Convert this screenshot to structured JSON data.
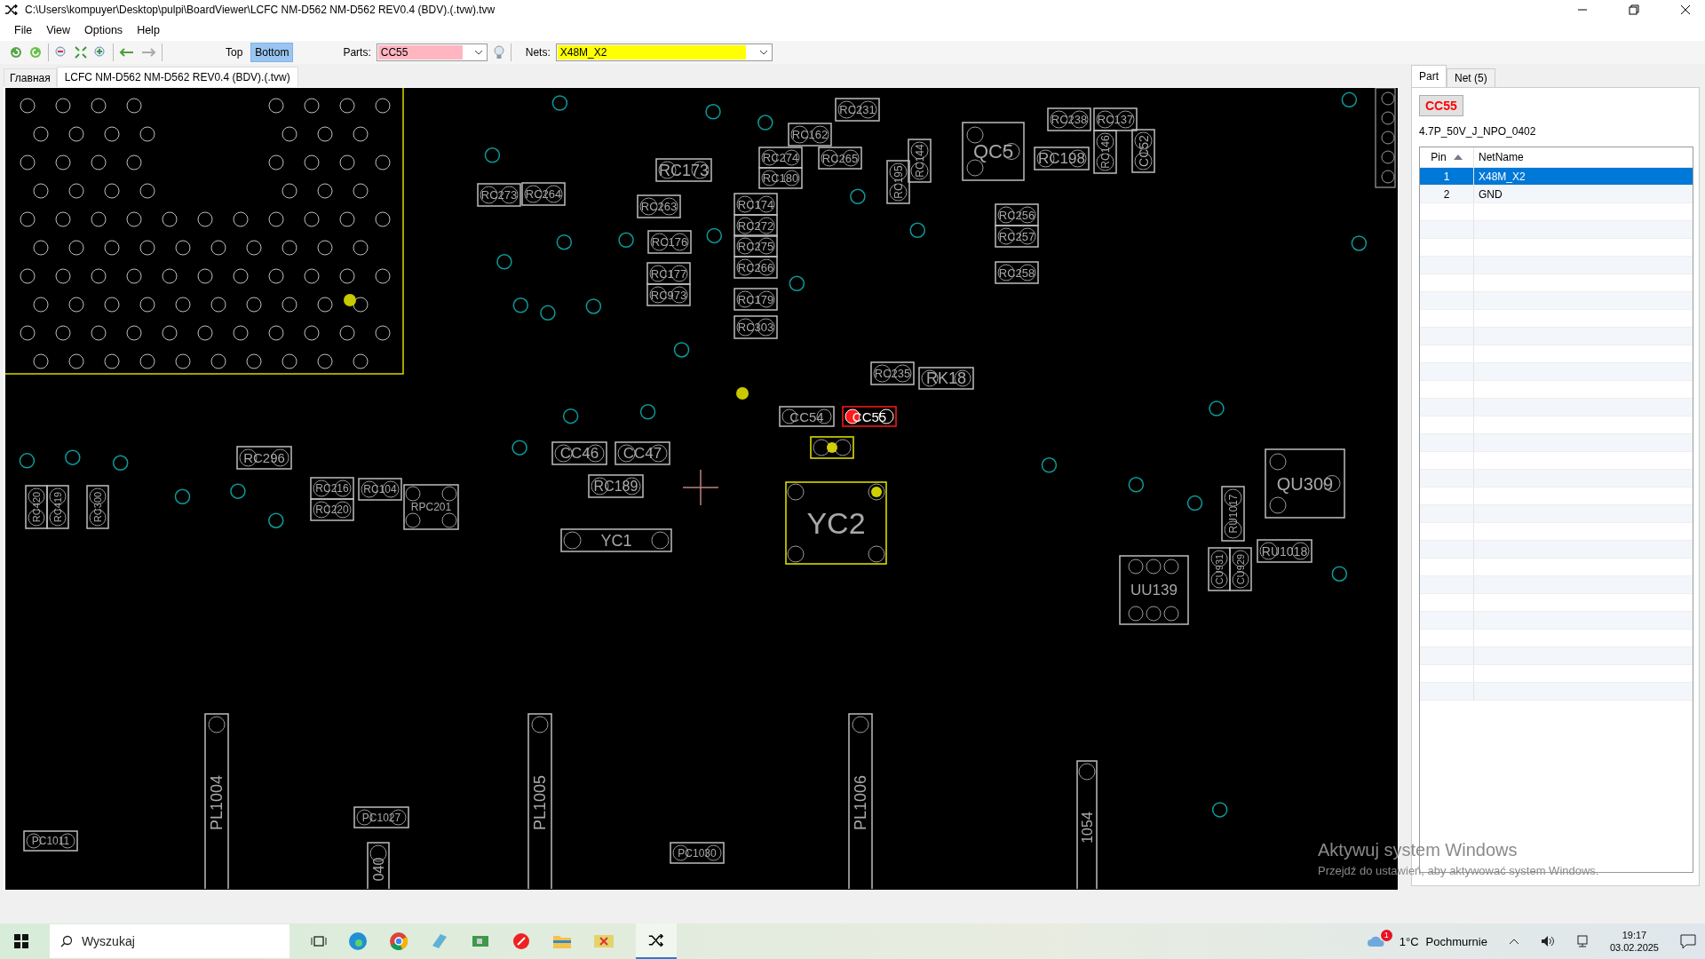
{
  "window": {
    "title": "C:\\Users\\kompuyer\\Desktop\\pulpi\\BoardViewer\\LCFC NM-D562 NM-D562 REV0.4 (BDV).(.tvw).tvw"
  },
  "menu": [
    "File",
    "View",
    "Options",
    "Help"
  ],
  "toolbar": {
    "sides": [
      {
        "label": "Top",
        "selected": false
      },
      {
        "label": "Bottom",
        "selected": true
      }
    ],
    "parts_label": "Parts:",
    "parts_value": "CC55",
    "nets_label": "Nets:",
    "nets_value": "X48M_X2"
  },
  "doc_tabs": [
    {
      "label": "Главная",
      "selected": false
    },
    {
      "label": "LCFC NM-D562 NM-D562 REV0.4 (BDV).(.tvw)",
      "selected": true
    }
  ],
  "board": {
    "parts": [
      {
        "label": "RC231",
        "selected": false,
        "highlighted": false
      },
      {
        "label": "RC162",
        "selected": false,
        "highlighted": false
      },
      {
        "label": "RC274",
        "selected": false,
        "highlighted": false
      },
      {
        "label": "RC180",
        "selected": false,
        "highlighted": false
      },
      {
        "label": "RC265",
        "selected": false,
        "highlighted": false
      },
      {
        "label": "RC173",
        "selected": false,
        "highlighted": false
      },
      {
        "label": "RC273",
        "selected": false,
        "highlighted": false
      },
      {
        "label": "RC264",
        "selected": false,
        "highlighted": false
      },
      {
        "label": "RC263",
        "selected": false,
        "highlighted": false
      },
      {
        "label": "RC174",
        "selected": false,
        "highlighted": false
      },
      {
        "label": "RC272",
        "selected": false,
        "highlighted": false
      },
      {
        "label": "RC275",
        "selected": false,
        "highlighted": false
      },
      {
        "label": "RC266",
        "selected": false,
        "highlighted": false
      },
      {
        "label": "RC176",
        "selected": false,
        "highlighted": false
      },
      {
        "label": "RC177",
        "selected": false,
        "highlighted": false
      },
      {
        "label": "RC973",
        "selected": false,
        "highlighted": false
      },
      {
        "label": "RC179",
        "selected": false,
        "highlighted": false
      },
      {
        "label": "RC303",
        "selected": false,
        "highlighted": false
      },
      {
        "label": "RC195",
        "selected": false,
        "highlighted": false
      },
      {
        "label": "RC144",
        "selected": false,
        "highlighted": false
      },
      {
        "label": "RC235",
        "selected": false,
        "highlighted": false
      },
      {
        "label": "RK18",
        "selected": false,
        "highlighted": false
      },
      {
        "label": "QC5",
        "selected": false,
        "highlighted": false
      },
      {
        "label": "RC238",
        "selected": false,
        "highlighted": false
      },
      {
        "label": "RC137",
        "selected": false,
        "highlighted": false
      },
      {
        "label": "RC198",
        "selected": false,
        "highlighted": false
      },
      {
        "label": "RC146",
        "selected": false,
        "highlighted": false
      },
      {
        "label": "CC52",
        "selected": false,
        "highlighted": false
      },
      {
        "label": "RC256",
        "selected": false,
        "highlighted": false
      },
      {
        "label": "RC257",
        "selected": false,
        "highlighted": false
      },
      {
        "label": "RC258",
        "selected": false,
        "highlighted": false
      },
      {
        "label": "QU309",
        "selected": false,
        "highlighted": false
      },
      {
        "label": "RU1017",
        "selected": false,
        "highlighted": false
      },
      {
        "label": "RU1018",
        "selected": false,
        "highlighted": false
      },
      {
        "label": "CU931",
        "selected": false,
        "highlighted": false
      },
      {
        "label": "CU929",
        "selected": false,
        "highlighted": false
      },
      {
        "label": "UU139",
        "selected": false,
        "highlighted": false
      },
      {
        "label": "RC296",
        "selected": false,
        "highlighted": false
      },
      {
        "label": "CC46",
        "selected": false,
        "highlighted": false
      },
      {
        "label": "CC47",
        "selected": false,
        "highlighted": false
      },
      {
        "label": "RC216",
        "selected": false,
        "highlighted": false
      },
      {
        "label": "RC220",
        "selected": false,
        "highlighted": false
      },
      {
        "label": "RC104",
        "selected": false,
        "highlighted": false
      },
      {
        "label": "RPC201",
        "selected": false,
        "highlighted": false
      },
      {
        "label": "RC189",
        "selected": false,
        "highlighted": false
      },
      {
        "label": "YC1",
        "selected": false,
        "highlighted": false
      },
      {
        "label": "RC420",
        "selected": false,
        "highlighted": false
      },
      {
        "label": "RC419",
        "selected": false,
        "highlighted": false
      },
      {
        "label": "RC300",
        "selected": false,
        "highlighted": false
      },
      {
        "label": "CC54",
        "selected": false,
        "highlighted": false
      },
      {
        "label": "CC55",
        "selected": true,
        "highlighted": false
      },
      {
        "selected": false,
        "highlighted": true
      },
      {
        "label": "YC2",
        "selected": false,
        "highlighted": true
      },
      {
        "label": "PL1004",
        "selected": false,
        "highlighted": false
      },
      {
        "label": "PL1005",
        "selected": false,
        "highlighted": false
      },
      {
        "label": "PL1006",
        "selected": false,
        "highlighted": false
      },
      {
        "label": "PC1011",
        "selected": false,
        "highlighted": false
      },
      {
        "label": "PC1027",
        "selected": false,
        "highlighted": false
      },
      {
        "label": "PC1030",
        "selected": false,
        "highlighted": false
      },
      {
        "label": "1054",
        "selected": false,
        "highlighted": false
      },
      {
        "label": "040",
        "selected": false,
        "highlighted": false
      }
    ]
  },
  "side_tabs": [
    {
      "label": "Part",
      "selected": true
    },
    {
      "label": "Net (5)",
      "selected": false
    }
  ],
  "part_info": {
    "name": "CC55",
    "description": "4.7P_50V_J_NPO_0402"
  },
  "pins_table": {
    "columns": [
      "Pin",
      "NetName"
    ],
    "rows": [
      {
        "pin": "1",
        "net": "X48M_X2",
        "selected": true
      },
      {
        "pin": "2",
        "net": "GND",
        "selected": false
      }
    ]
  },
  "activation_notice": {
    "title": "Aktywuj system Windows",
    "text": "Przejdź do ustawień, aby aktywować system Windows."
  },
  "taskbar": {
    "search_placeholder": "Wyszukaj",
    "weather": "1°C",
    "weather_text": "Pochmurnie",
    "weather_badge": "1",
    "time": "19:17",
    "date": "03.02.2025"
  }
}
